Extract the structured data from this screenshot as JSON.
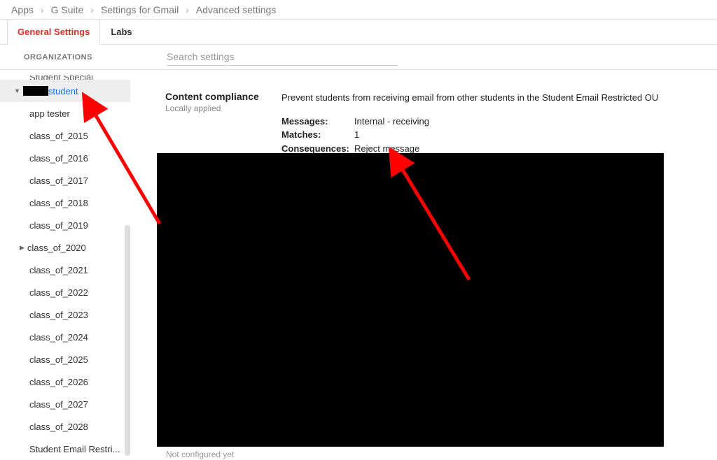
{
  "breadcrumb": [
    "Apps",
    "G Suite",
    "Settings for Gmail",
    "Advanced settings"
  ],
  "tabs": [
    {
      "label": "General Settings",
      "active": true
    },
    {
      "label": "Labs",
      "active": false
    }
  ],
  "org_header": "ORGANIZATIONS",
  "search": {
    "placeholder": "Search settings"
  },
  "orgs": [
    {
      "label": "Student Special",
      "sel": false,
      "cut": true
    },
    {
      "label": "student",
      "sel": true,
      "redact": true,
      "caret": "down"
    },
    {
      "label": "app tester"
    },
    {
      "label": "class_of_2015"
    },
    {
      "label": "class_of_2016"
    },
    {
      "label": "class_of_2017"
    },
    {
      "label": "class_of_2018"
    },
    {
      "label": "class_of_2019"
    },
    {
      "label": "class_of_2020",
      "caret": "right"
    },
    {
      "label": "class_of_2021"
    },
    {
      "label": "class_of_2022"
    },
    {
      "label": "class_of_2023"
    },
    {
      "label": "class_of_2024"
    },
    {
      "label": "class_of_2025"
    },
    {
      "label": "class_of_2026"
    },
    {
      "label": "class_of_2027"
    },
    {
      "label": "class_of_2028"
    },
    {
      "label": "Student Email Restri..."
    }
  ],
  "setting": {
    "title": "Content compliance",
    "sub": "Locally applied",
    "desc": "Prevent students from receiving email from other students in the Student Email Restricted OU",
    "rows": [
      {
        "k": "Messages:",
        "v": "Internal - receiving"
      },
      {
        "k": "Matches:",
        "v": "1"
      },
      {
        "k": "Consequences:",
        "v": "Reject message"
      }
    ]
  },
  "not_configured": "Not configured yet",
  "colors": {
    "accent_red": "#d93025",
    "link_blue": "#1a73e8",
    "arrow_red": "#ff0000"
  }
}
